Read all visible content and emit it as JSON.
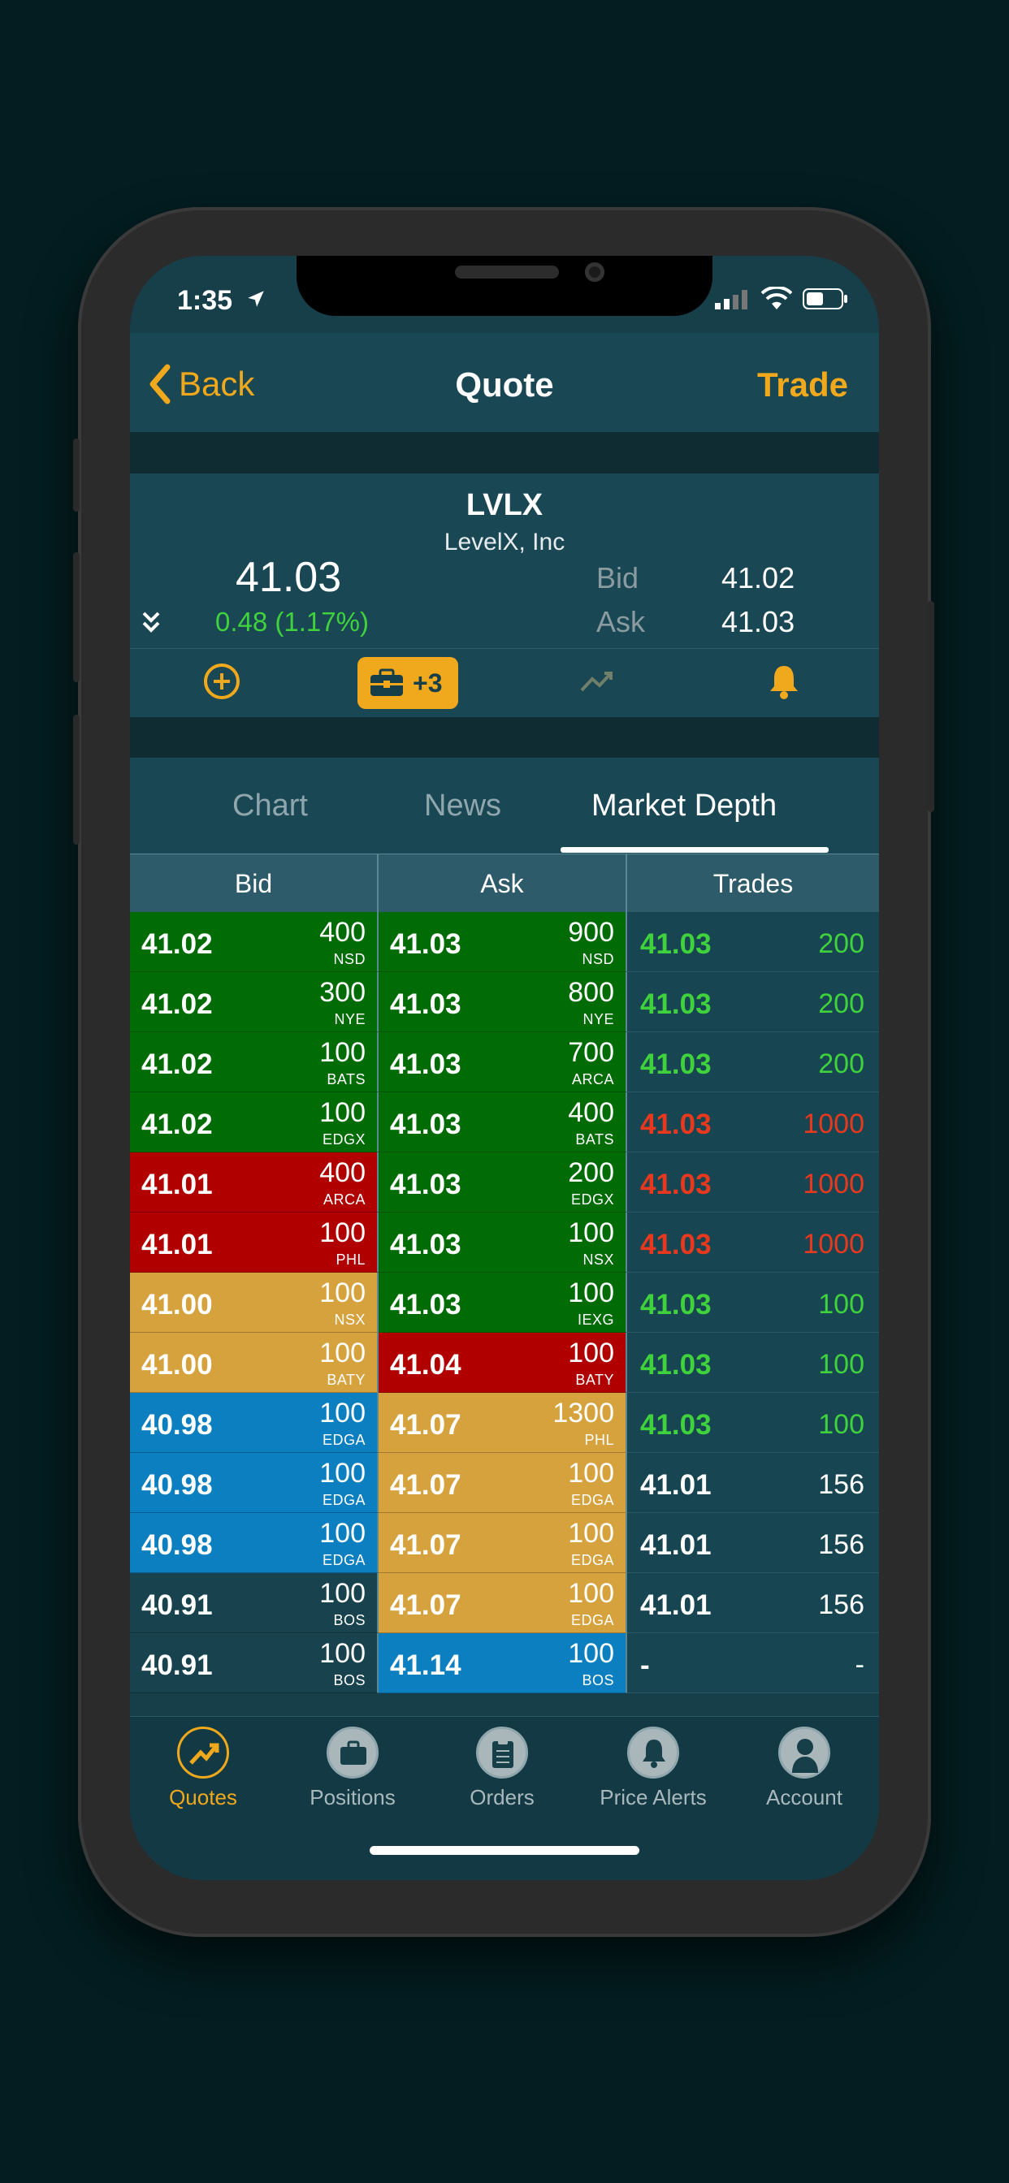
{
  "status": {
    "time": "1:35"
  },
  "nav": {
    "back_label": "Back",
    "title": "Quote",
    "trade_label": "Trade"
  },
  "quote": {
    "symbol": "LVLX",
    "company": "LevelX, Inc",
    "last": "41.03",
    "change": "0.48 (1.17%)",
    "bid_label": "Bid",
    "bid": "41.02",
    "ask_label": "Ask",
    "ask": "41.03",
    "positions_badge": "+3"
  },
  "tabs": [
    {
      "label": "Chart",
      "active": false
    },
    {
      "label": "News",
      "active": false
    },
    {
      "label": "Market Depth",
      "active": true
    }
  ],
  "depth": {
    "headers": {
      "bid": "Bid",
      "ask": "Ask",
      "trades": "Trades"
    },
    "colors": {
      "green": "#016c06",
      "red": "#b00000",
      "gold": "#d6a23e",
      "blue": "#0b7fbf",
      "dark": "#17424e"
    },
    "bids": [
      {
        "price": "41.02",
        "size": "400",
        "exchange": "NSD",
        "color": "green"
      },
      {
        "price": "41.02",
        "size": "300",
        "exchange": "NYE",
        "color": "green"
      },
      {
        "price": "41.02",
        "size": "100",
        "exchange": "BATS",
        "color": "green"
      },
      {
        "price": "41.02",
        "size": "100",
        "exchange": "EDGX",
        "color": "green"
      },
      {
        "price": "41.01",
        "size": "400",
        "exchange": "ARCA",
        "color": "red"
      },
      {
        "price": "41.01",
        "size": "100",
        "exchange": "PHL",
        "color": "red"
      },
      {
        "price": "41.00",
        "size": "100",
        "exchange": "NSX",
        "color": "gold"
      },
      {
        "price": "41.00",
        "size": "100",
        "exchange": "BATY",
        "color": "gold"
      },
      {
        "price": "40.98",
        "size": "100",
        "exchange": "EDGA",
        "color": "blue"
      },
      {
        "price": "40.98",
        "size": "100",
        "exchange": "EDGA",
        "color": "blue"
      },
      {
        "price": "40.98",
        "size": "100",
        "exchange": "EDGA",
        "color": "blue"
      },
      {
        "price": "40.91",
        "size": "100",
        "exchange": "BOS",
        "color": "dark"
      },
      {
        "price": "40.91",
        "size": "100",
        "exchange": "BOS",
        "color": "dark"
      }
    ],
    "asks": [
      {
        "price": "41.03",
        "size": "900",
        "exchange": "NSD",
        "color": "green"
      },
      {
        "price": "41.03",
        "size": "800",
        "exchange": "NYE",
        "color": "green"
      },
      {
        "price": "41.03",
        "size": "700",
        "exchange": "ARCA",
        "color": "green"
      },
      {
        "price": "41.03",
        "size": "400",
        "exchange": "BATS",
        "color": "green"
      },
      {
        "price": "41.03",
        "size": "200",
        "exchange": "EDGX",
        "color": "green"
      },
      {
        "price": "41.03",
        "size": "100",
        "exchange": "NSX",
        "color": "green"
      },
      {
        "price": "41.03",
        "size": "100",
        "exchange": "IEXG",
        "color": "green"
      },
      {
        "price": "41.04",
        "size": "100",
        "exchange": "BATY",
        "color": "red"
      },
      {
        "price": "41.07",
        "size": "1300",
        "exchange": "PHL",
        "color": "gold"
      },
      {
        "price": "41.07",
        "size": "100",
        "exchange": "EDGA",
        "color": "gold"
      },
      {
        "price": "41.07",
        "size": "100",
        "exchange": "EDGA",
        "color": "gold"
      },
      {
        "price": "41.07",
        "size": "100",
        "exchange": "EDGA",
        "color": "gold"
      },
      {
        "price": "41.14",
        "size": "100",
        "exchange": "BOS",
        "color": "blue"
      }
    ],
    "trades": [
      {
        "price": "41.03",
        "size": "200",
        "color": "#3fd23c"
      },
      {
        "price": "41.03",
        "size": "200",
        "color": "#3fd23c"
      },
      {
        "price": "41.03",
        "size": "200",
        "color": "#3fd23c"
      },
      {
        "price": "41.03",
        "size": "1000",
        "color": "#e8391e"
      },
      {
        "price": "41.03",
        "size": "1000",
        "color": "#e8391e"
      },
      {
        "price": "41.03",
        "size": "1000",
        "color": "#e8391e"
      },
      {
        "price": "41.03",
        "size": "100",
        "color": "#3fd23c"
      },
      {
        "price": "41.03",
        "size": "100",
        "color": "#3fd23c"
      },
      {
        "price": "41.03",
        "size": "100",
        "color": "#3fd23c"
      },
      {
        "price": "41.01",
        "size": "156",
        "color": "#ffffff"
      },
      {
        "price": "41.01",
        "size": "156",
        "color": "#ffffff"
      },
      {
        "price": "41.01",
        "size": "156",
        "color": "#ffffff"
      },
      {
        "price": "-",
        "size": "-",
        "color": "#ffffff"
      }
    ]
  },
  "tabbar": [
    {
      "label": "Quotes",
      "icon": "quotes-icon",
      "active": true
    },
    {
      "label": "Positions",
      "icon": "briefcase-icon",
      "active": false
    },
    {
      "label": "Orders",
      "icon": "clipboard-icon",
      "active": false
    },
    {
      "label": "Price Alerts",
      "icon": "bell-icon",
      "active": false
    },
    {
      "label": "Account",
      "icon": "person-icon",
      "active": false
    }
  ]
}
